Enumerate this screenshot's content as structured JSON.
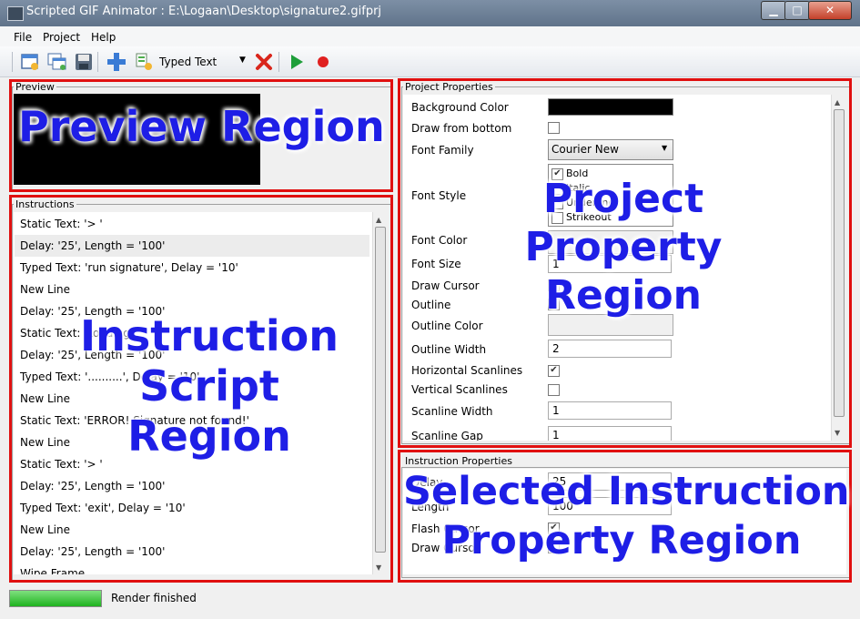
{
  "window": {
    "title": "Scripted GIF Animator : E:\\Logaan\\Desktop\\signature2.gifprj",
    "min_label": "▁",
    "max_label": "□",
    "close_label": "✕"
  },
  "menu": [
    "File",
    "Project",
    "Help"
  ],
  "toolbar": {
    "combo_value": "Typed Text",
    "icons": [
      "new-project-icon",
      "add-frames-icon",
      "save-icon",
      "add-icon",
      "edit-icon",
      "delete-icon",
      "play-icon",
      "record-icon"
    ]
  },
  "preview": {
    "label": "Preview",
    "overlay": "Preview Region"
  },
  "instructions": {
    "label": "Instructions",
    "overlay_lines": [
      "Instruction",
      "Script",
      "Region"
    ],
    "items": [
      "Static Text: '> '",
      "Delay: '25', Length = '100'",
      "Typed Text: 'run signature', Delay = '10'",
      "New Line",
      "Delay: '25', Length = '100'",
      "Static Text: 'Loading",
      "Delay: '25', Length = '100'",
      "Typed Text: '..........', Delay = '10'",
      "New Line",
      "Static Text: 'ERROR! Signature not found!'",
      "New Line",
      "Static Text: '> '",
      "Delay: '25', Length = '100'",
      "Typed Text: 'exit', Delay = '10'",
      "New Line",
      "Delay: '25', Length = '100'",
      "Wipe Frame"
    ]
  },
  "project_properties": {
    "label": "Project Properties",
    "overlay_lines": [
      "Project",
      "Property",
      "Region"
    ],
    "background_color_label": "Background Color",
    "draw_from_bottom_label": "Draw from bottom",
    "font_family_label": "Font Family",
    "font_family_value": "Courier New",
    "font_style_label": "Font Style",
    "font_styles": [
      "Bold",
      "Italic",
      "Underline",
      "Strikeout"
    ],
    "font_color_label": "Font Color",
    "font_size_label": "Font Size",
    "font_size_value": "1",
    "draw_cursor_label": "Draw Cursor",
    "outline_label": "Outline",
    "outline_color_label": "Outline Color",
    "outline_width_label": "Outline Width",
    "outline_width_value": "2",
    "horizontal_scanlines_label": "Horizontal Scanlines",
    "vertical_scanlines_label": "Vertical Scanlines",
    "scanline_width_label": "Scanline Width",
    "scanline_width_value": "1",
    "scanline_gap_label": "Scanline Gap",
    "scanline_gap_value": "1",
    "colors": {
      "background": "#000000"
    }
  },
  "instruction_properties": {
    "label": "Instruction Properties",
    "overlay_lines": [
      "Selected Instruction",
      "Property Region"
    ],
    "delay_label": "Delay",
    "delay_value": "25",
    "length_label": "Length",
    "length_value": "100",
    "flash_cursor_label": "Flash Cursor",
    "draw_cursor_label": "Draw Cursor"
  },
  "status": {
    "text": "Render finished",
    "progress": 1.0
  }
}
